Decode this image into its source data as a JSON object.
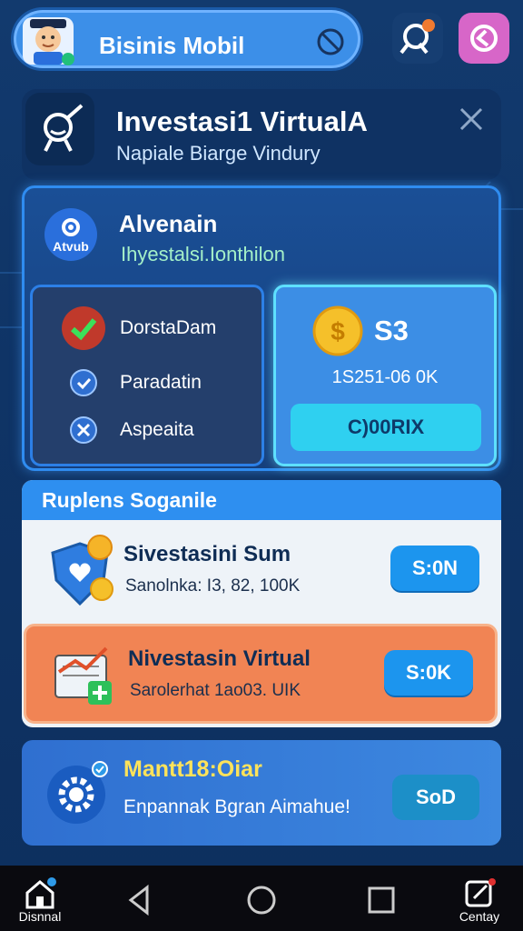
{
  "colors": {
    "accent": "#2e8ff0",
    "card_orange": "#f18454",
    "promo_title": "#ffe35a",
    "panel_border": "#2f8cf0"
  },
  "topbar": {
    "title": "Bisinis Mobil",
    "avatar_icon": "user-avatar-icon",
    "pill_action_icon": "no-entry-icon",
    "search_icon": "search-icon",
    "pink_icon": "chat-icon"
  },
  "header": {
    "title": "Investasi1 VirtualA",
    "subtitle": "Napiale Biarge Vindury",
    "icon": "investment-icon",
    "close_icon": "close-icon"
  },
  "panel": {
    "badge_text": "Atvub",
    "title": "Alvenain",
    "subtitle": "Ihyestalsi.Ionthilon",
    "status": [
      {
        "label": "DorstaDam",
        "icon": "check-icon"
      },
      {
        "label": "Paradatin",
        "icon": "shield-check-icon"
      },
      {
        "label": "Aspeaita",
        "icon": "x-icon"
      }
    ],
    "balance": {
      "amount": "S3",
      "detail": "1S251-06 0K",
      "button": "C)00RIX"
    }
  },
  "section": {
    "title": "Ruplens Soganile",
    "items": [
      {
        "title": "Sivestasini Sum",
        "subtitle": "Sanolnka: I3, 82, 100K",
        "button": "S:0N"
      },
      {
        "title": "Nivestasin Virtual",
        "subtitle": "Sarolerhat 1ao03. UIK",
        "button": "S:0K"
      }
    ]
  },
  "promo": {
    "title": "Mantt18:Oiar",
    "subtitle": "Enpannak Bgran Aimahue!",
    "button": "SoD"
  },
  "nav": {
    "items": [
      {
        "label": "Disnnal",
        "icon": "home-icon"
      },
      {
        "label": "",
        "icon": "back-icon"
      },
      {
        "label": "",
        "icon": "circle-home-icon"
      },
      {
        "label": "",
        "icon": "recents-icon"
      },
      {
        "label": "Centay",
        "icon": "edit-icon"
      }
    ]
  }
}
